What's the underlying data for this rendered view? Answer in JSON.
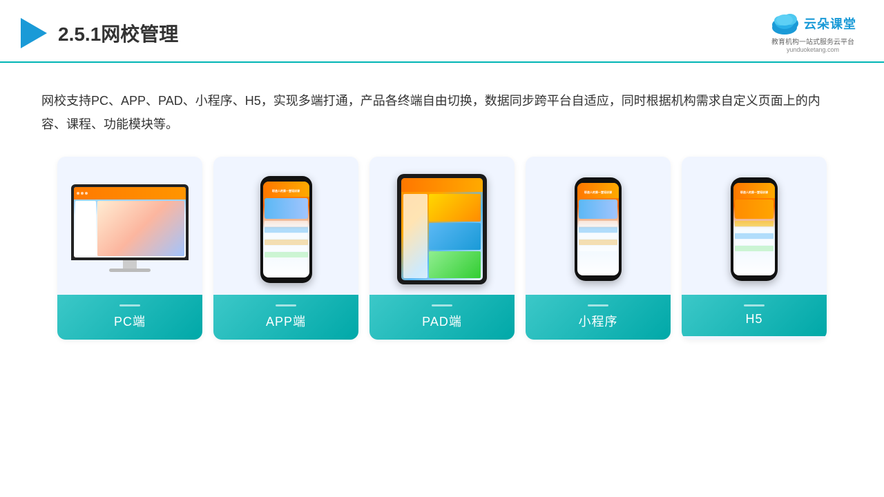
{
  "header": {
    "title": "2.5.1网校管理",
    "logo_name": "云朵课堂",
    "logo_url": "yunduoketang.com",
    "logo_tagline": "教育机构一站\n式服务云平台"
  },
  "description": {
    "text": "网校支持PC、APP、PAD、小程序、H5，实现多端打通，产品各终端自由切换，数据同步跨平台自适应，同时根据机构需求自定义页面上的内容、课程、功能模块等。"
  },
  "cards": [
    {
      "id": "pc",
      "label": "PC端"
    },
    {
      "id": "app",
      "label": "APP端"
    },
    {
      "id": "pad",
      "label": "PAD端"
    },
    {
      "id": "mini",
      "label": "小程序"
    },
    {
      "id": "h5",
      "label": "H5"
    }
  ]
}
